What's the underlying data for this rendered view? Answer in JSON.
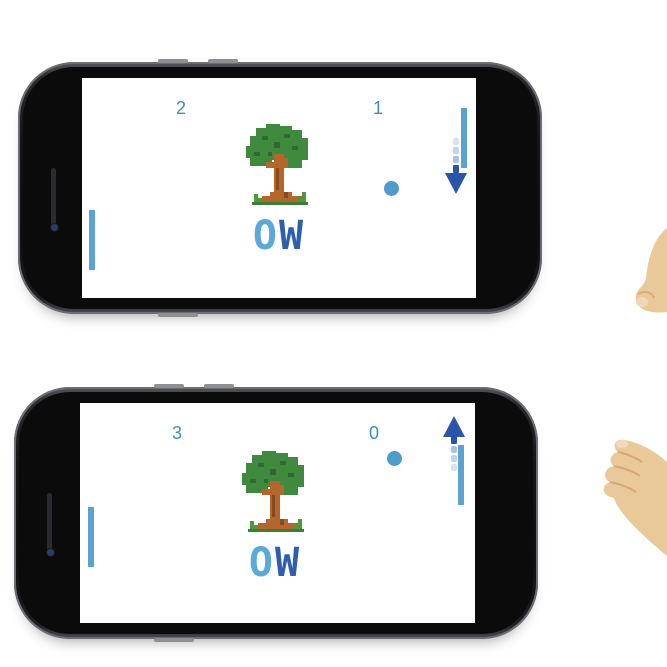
{
  "scene": {
    "top": {
      "score_left": "2",
      "score_right": "1",
      "arrow_direction": "down",
      "logo": {
        "letter_o": "O",
        "letter_w": "W"
      }
    },
    "bottom": {
      "score_left": "3",
      "score_right": "0",
      "arrow_direction": "up",
      "logo": {
        "letter_o": "O",
        "letter_w": "W"
      }
    }
  },
  "colors": {
    "accent": "#4f9bcc",
    "score_text": "#3a8fc4",
    "arrow": "#2a55a8",
    "logo_o": "#5aa9d6",
    "logo_w": "#2d5fae",
    "tree_green": "#3f8a3e",
    "tree_trunk": "#b4672d",
    "skin": "#e9c89a"
  }
}
